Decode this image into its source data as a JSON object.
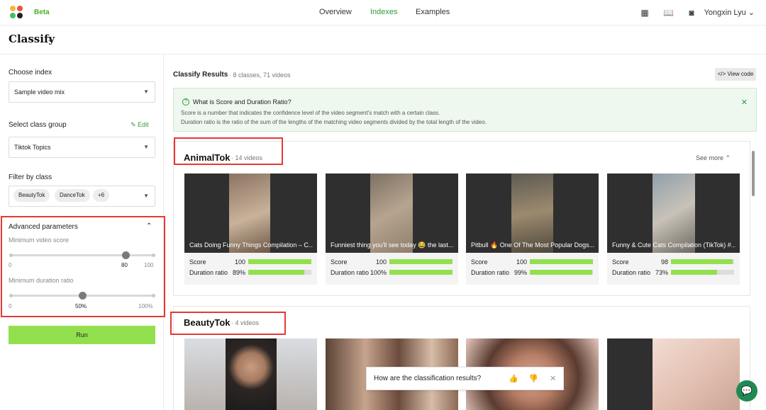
{
  "nav": {
    "beta": "Beta",
    "links": [
      "Overview",
      "Indexes",
      "Examples"
    ],
    "active": "Indexes",
    "user": "Yongxin Lyu"
  },
  "page": {
    "title": "Classify"
  },
  "sidebar": {
    "choose_index_label": "Choose index",
    "index_value": "Sample video mix",
    "class_group_label": "Select class group",
    "edit_label": "Edit",
    "class_group_value": "Tiktok Topics",
    "filter_label": "Filter by class",
    "filter_chips": [
      "BeautyTok",
      "DanceTok",
      "+6"
    ],
    "advanced_title": "Advanced parameters",
    "min_score_label": "Minimum video score",
    "min_score": {
      "min": "0",
      "value": "80",
      "max": "100",
      "fraction": 0.8
    },
    "min_ratio_label": "Minimum duration ratio",
    "min_ratio": {
      "min": "0",
      "value": "50%",
      "max": "100%",
      "fraction": 0.5
    },
    "run_label": "Run"
  },
  "results": {
    "title": "Classify Results",
    "subtitle": "8 classes, 71 videos",
    "view_code": "View code",
    "info_title": "What is Score and Duration Ratio?",
    "info_line1": "Score is a number that indicates the confidence level of the video segment's match with a certain class.",
    "info_line2": "Duration ratio is the ratio of the sum of the lengths of the matching video segments divided by the total length of the video.",
    "see_more": "See more",
    "score_label": "Score",
    "duration_label": "Duration ratio"
  },
  "groups": [
    {
      "name": "AnimalTok",
      "count": "14 videos",
      "videos": [
        {
          "title": "Cats Doing Funny Things Compilation – C...",
          "score": "100",
          "duration": "89%",
          "score_frac": 1.0,
          "duration_frac": 0.89
        },
        {
          "title": "Funniest thing you'll see today 😂 the last...",
          "score": "100",
          "duration": "100%",
          "score_frac": 1.0,
          "duration_frac": 1.0
        },
        {
          "title": "Pitbull 🔥 One Of The Most Popular Dogs...",
          "score": "100",
          "duration": "99%",
          "score_frac": 1.0,
          "duration_frac": 0.99
        },
        {
          "title": "Funny & Cute Cats Compilation (TikTok) #...",
          "score": "98",
          "duration": "73%",
          "score_frac": 0.98,
          "duration_frac": 0.73
        }
      ]
    },
    {
      "name": "BeautyTok",
      "count": "4 videos"
    }
  ],
  "feedback": {
    "question": "How are the classification results?"
  },
  "colors": {
    "accent": "#2e9a3a",
    "run": "#93e04e",
    "highlight": "#e53935"
  }
}
